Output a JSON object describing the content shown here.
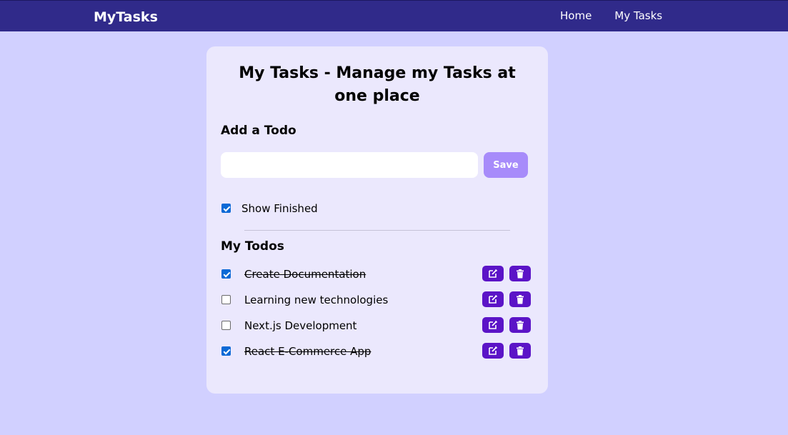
{
  "navbar": {
    "brand": "MyTasks",
    "links": [
      "Home",
      "My Tasks"
    ]
  },
  "main": {
    "title": "My Tasks - Manage my Tasks at one place",
    "add_section_title": "Add a Todo",
    "input": {
      "value": "",
      "placeholder": ""
    },
    "save_label": "Save",
    "show_finished": {
      "label": "Show Finished",
      "checked": true
    },
    "todos_section_title": "My Todos",
    "todos": [
      {
        "text": "Create Documentation",
        "done": true
      },
      {
        "text": "Learning new technologies",
        "done": false
      },
      {
        "text": "Next.js Development",
        "done": false
      },
      {
        "text": "React E-Commerce App",
        "done": true
      }
    ],
    "row_icons": [
      "edit-icon",
      "delete-icon"
    ]
  },
  "colors": {
    "page_background": "#d1d0ff",
    "navbar": "#302a8a",
    "card": "#ebe8fd",
    "save_button": "#a78bfa",
    "action_button": "#5b14c7",
    "checkbox": "#0b69d6"
  }
}
